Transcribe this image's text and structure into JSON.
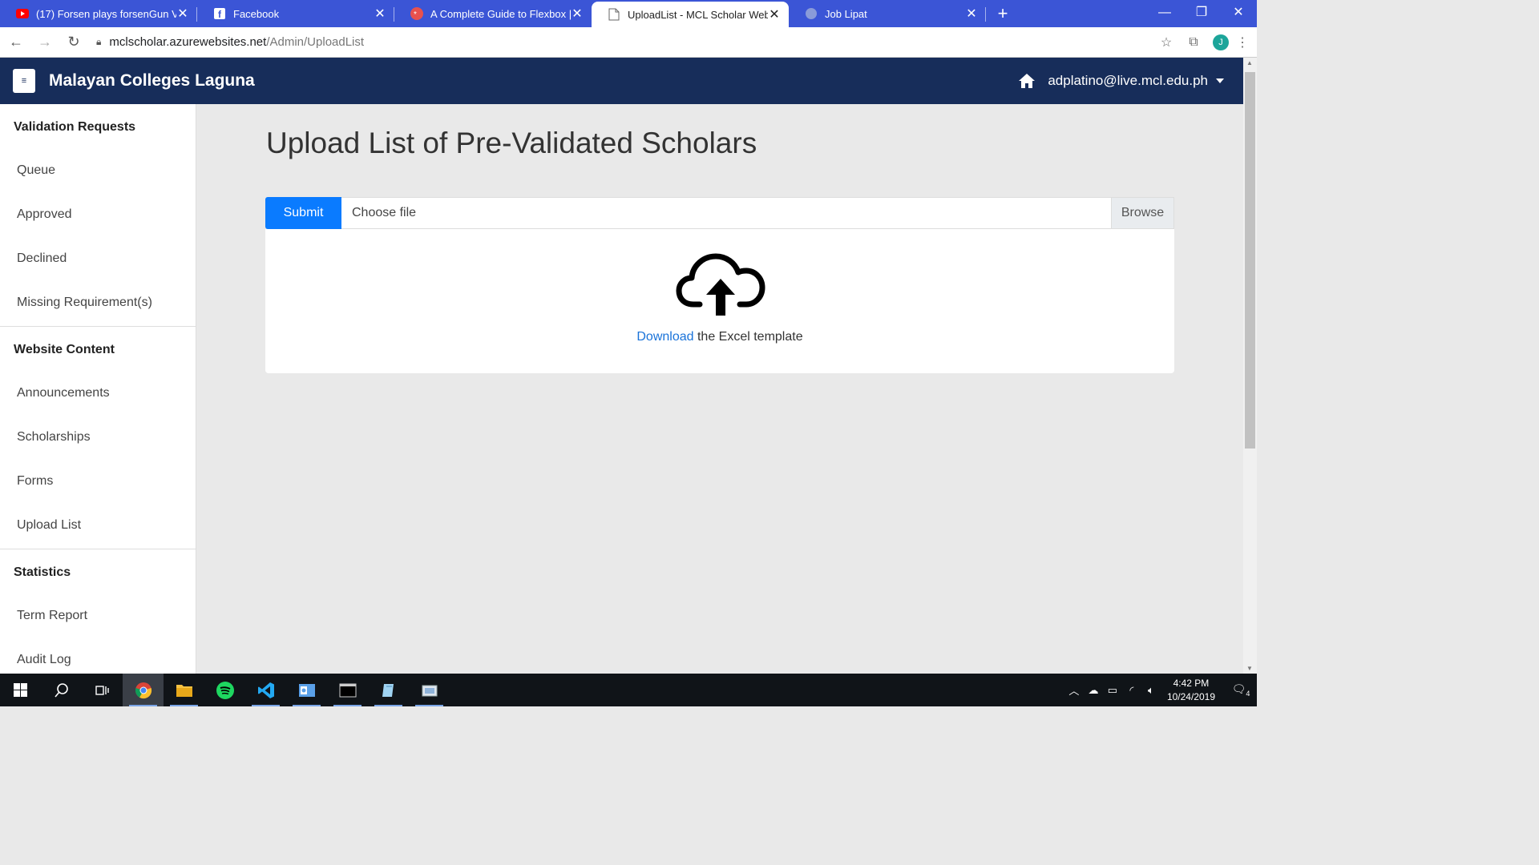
{
  "browser": {
    "tabs": [
      {
        "title": "(17) Forsen plays forsenGun V1 -",
        "icon": "youtube-icon",
        "active": false
      },
      {
        "title": "Facebook",
        "icon": "facebook-icon",
        "active": false
      },
      {
        "title": "A Complete Guide to Flexbox | C",
        "icon": "css-tricks-icon",
        "active": false
      },
      {
        "title": "UploadList - MCL Scholar Websit",
        "icon": "page-icon",
        "active": true
      },
      {
        "title": "Job Lipat",
        "icon": "globe-icon",
        "active": false
      }
    ],
    "new_tab": "+",
    "url_host": "mclscholar.azurewebsites.net",
    "url_path": "/Admin/UploadList",
    "profile_initial": "J"
  },
  "header": {
    "menu_icon": "≡",
    "brand": "Malayan Colleges Laguna",
    "user_email": "adplatino@live.mcl.edu.ph"
  },
  "sidebar": {
    "sections": [
      {
        "title": "Validation Requests",
        "items": [
          "Queue",
          "Approved",
          "Declined",
          "Missing Requirement(s)"
        ]
      },
      {
        "title": "Website Content",
        "items": [
          "Announcements",
          "Scholarships",
          "Forms",
          "Upload List"
        ]
      },
      {
        "title": "Statistics",
        "items": [
          "Term Report",
          "Audit Log"
        ]
      }
    ]
  },
  "main": {
    "page_title": "Upload List of Pre-Validated Scholars",
    "submit_label": "Submit",
    "file_placeholder": "Choose file",
    "browse_label": "Browse",
    "download_link": "Download",
    "download_text": " the Excel template"
  },
  "taskbar": {
    "time": "4:42 PM",
    "date": "10/24/2019",
    "notifications": "4"
  },
  "colors": {
    "tab_strip": "#3b55d6",
    "navbar": "#172d5a",
    "primary_button": "#0a7bff",
    "link": "#1a73d9"
  }
}
